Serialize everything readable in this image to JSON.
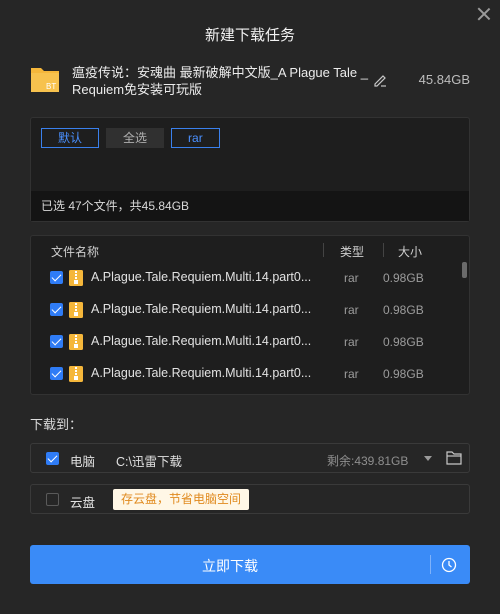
{
  "dialog": {
    "title": "新建下载任务"
  },
  "file": {
    "name": "瘟疫传说：安魂曲 最新破解中文版_A Plague Tale _ Requiem免安装可玩版",
    "icon_label": "BT",
    "total_size": "45.84GB"
  },
  "filter_tags": [
    {
      "label": "默认",
      "active": true
    },
    {
      "label": "全选",
      "active": false
    },
    {
      "label": "rar",
      "active": true
    }
  ],
  "selection_summary": "已选 47个文件，共45.84GB",
  "file_list": {
    "headers": {
      "name": "文件名称",
      "type": "类型",
      "size": "大小"
    },
    "rows": [
      {
        "name": "A.Plague.Tale.Requiem.Multi.14.part0...",
        "type": "rar",
        "size": "0.98GB",
        "checked": true
      },
      {
        "name": "A.Plague.Tale.Requiem.Multi.14.part0...",
        "type": "rar",
        "size": "0.98GB",
        "checked": true
      },
      {
        "name": "A.Plague.Tale.Requiem.Multi.14.part0...",
        "type": "rar",
        "size": "0.98GB",
        "checked": true
      },
      {
        "name": "A.Plague.Tale.Requiem.Multi.14.part0...",
        "type": "rar",
        "size": "0.98GB",
        "checked": true
      }
    ]
  },
  "download_to": {
    "label": "下载到：",
    "pc": {
      "label": "电脑",
      "path": "C:\\迅雷下载",
      "free": "剩余:439.81GB",
      "checked": true
    },
    "cloud": {
      "label": "云盘",
      "tip": "存云盘，节省电脑空间",
      "checked": false
    }
  },
  "actions": {
    "download_now": "立即下载"
  },
  "colors": {
    "accent": "#3a8bf7",
    "background": "#262626",
    "file_icon": "#f5b73b",
    "tip_text": "#e08a1e"
  }
}
